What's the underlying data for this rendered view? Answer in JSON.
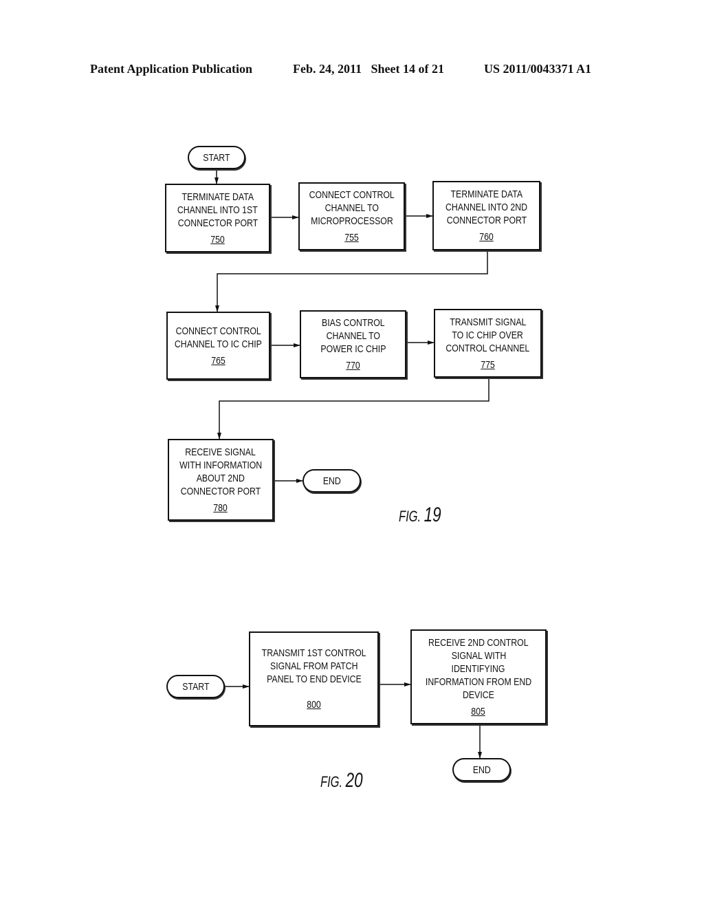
{
  "header": {
    "left": "Patent Application Publication",
    "date_sheet": "Feb. 24, 2011   Sheet 14 of 21",
    "pub_number": "US 2011/0043371 A1"
  },
  "fig19": {
    "label_prefix": "FIG.",
    "label_number": "19",
    "start": "START",
    "end": "END",
    "steps": [
      {
        "lines": [
          "TERMINATE DATA",
          "CHANNEL INTO 1ST",
          "CONNECTOR PORT"
        ],
        "ref": "750"
      },
      {
        "lines": [
          "CONNECT CONTROL",
          "CHANNEL TO",
          "MICROPROCESSOR"
        ],
        "ref": "755"
      },
      {
        "lines": [
          "TERMINATE DATA",
          "CHANNEL INTO 2ND",
          "CONNECTOR PORT"
        ],
        "ref": "760"
      },
      {
        "lines": [
          "CONNECT CONTROL",
          "CHANNEL TO IC CHIP"
        ],
        "ref": "765"
      },
      {
        "lines": [
          "BIAS CONTROL",
          "CHANNEL TO",
          "POWER IC CHIP"
        ],
        "ref": "770"
      },
      {
        "lines": [
          "TRANSMIT SIGNAL",
          "TO IC CHIP OVER",
          "CONTROL CHANNEL"
        ],
        "ref": "775"
      },
      {
        "lines": [
          "RECEIVE SIGNAL",
          "WITH INFORMATION",
          "ABOUT 2ND",
          "CONNECTOR PORT"
        ],
        "ref": "780"
      }
    ]
  },
  "fig20": {
    "label_prefix": "FIG.",
    "label_number": "20",
    "start": "START",
    "end": "END",
    "steps": [
      {
        "lines": [
          "TRANSMIT 1ST CONTROL",
          "SIGNAL FROM PATCH",
          "PANEL TO END DEVICE"
        ],
        "ref": "800"
      },
      {
        "lines": [
          "RECEIVE 2ND CONTROL",
          "SIGNAL WITH",
          "IDENTIFYING",
          "INFORMATION FROM END",
          "DEVICE"
        ],
        "ref": "805"
      }
    ]
  }
}
